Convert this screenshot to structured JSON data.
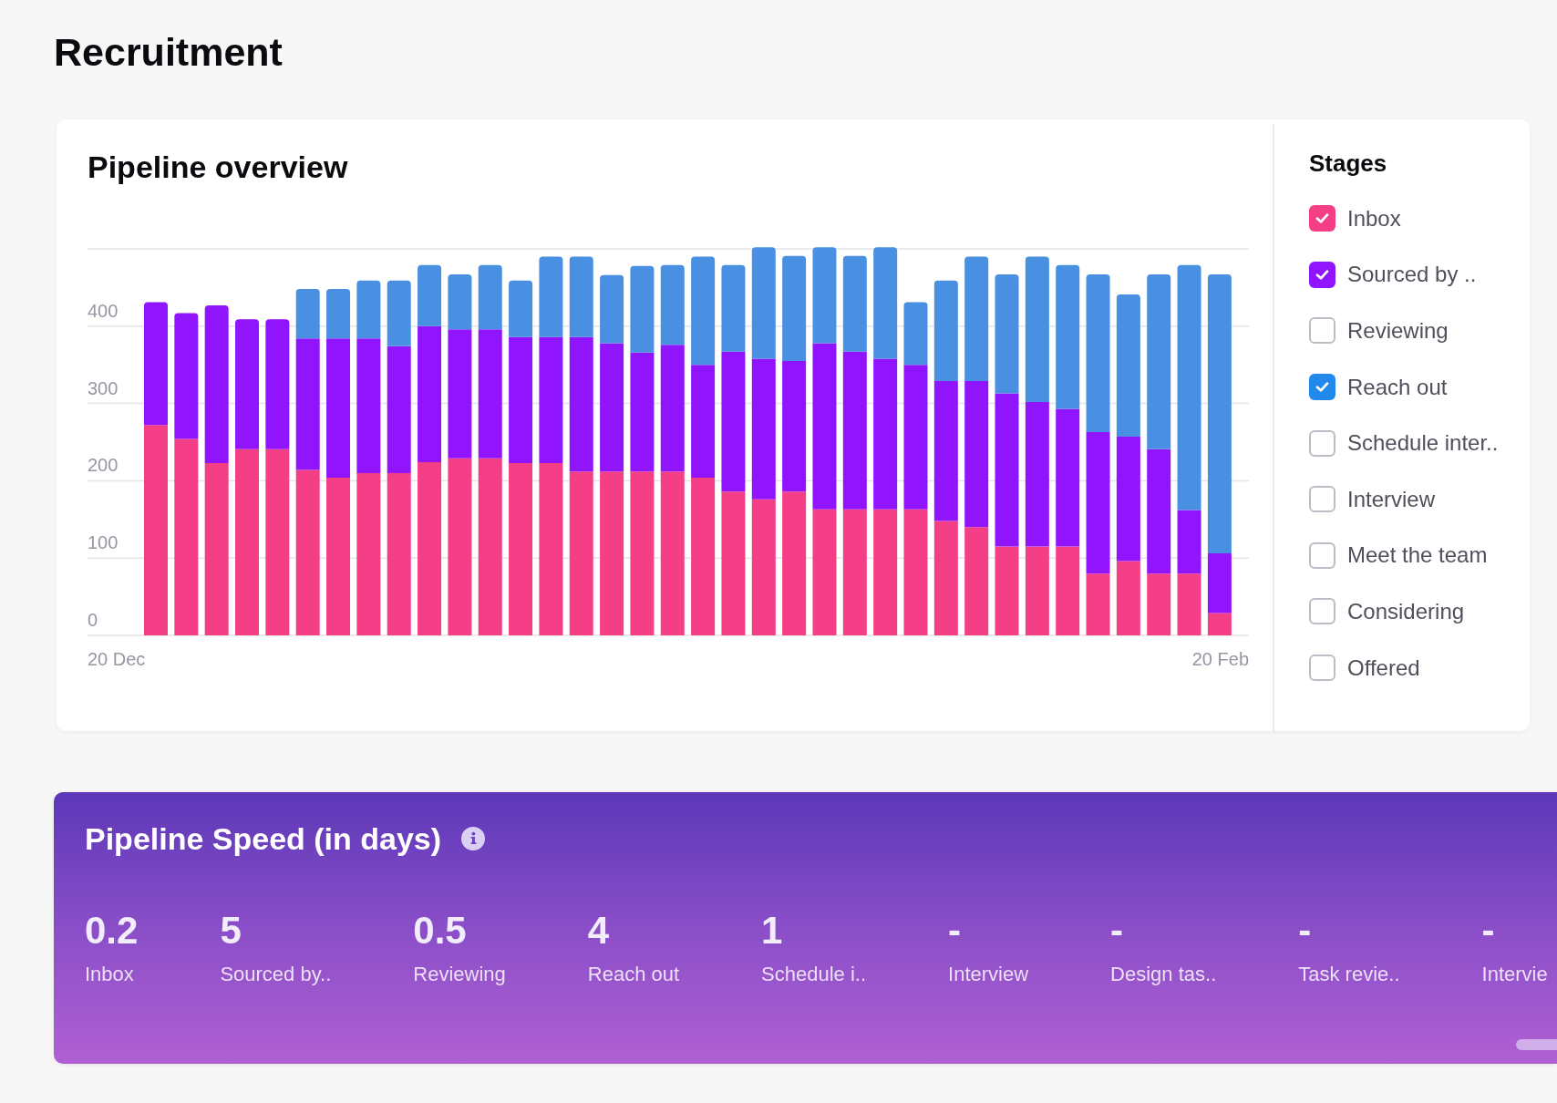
{
  "page": {
    "title": "Recruitment"
  },
  "pipeline_overview": {
    "title": "Pipeline overview",
    "x_range_labels": [
      "20 Dec",
      "20 Feb"
    ],
    "chart_data": {
      "type": "bar",
      "stacked": true,
      "grid": true,
      "ylim": [
        0,
        500
      ],
      "yticks": [
        0,
        100,
        200,
        300,
        400
      ],
      "series": [
        {
          "color": "#f43f86",
          "values": [
            272,
            254,
            223,
            241,
            241,
            214,
            204,
            210,
            210,
            224,
            229,
            229,
            223,
            223,
            212,
            212,
            212,
            212,
            204,
            186,
            176,
            186,
            163,
            163,
            163,
            163,
            148,
            140,
            115,
            115,
            115,
            80,
            96,
            80,
            80,
            29
          ]
        },
        {
          "color": "#9115fc",
          "values": [
            159,
            163,
            204,
            168,
            168,
            170,
            180,
            174,
            164,
            176,
            167,
            167,
            163,
            163,
            174,
            166,
            154,
            164,
            146,
            181,
            182,
            169,
            215,
            204,
            195,
            187,
            181,
            189,
            198,
            187,
            178,
            183,
            161,
            161,
            82,
            77
          ]
        },
        {
          "color": "#4a90e2",
          "values": [
            0,
            0,
            0,
            0,
            0,
            64,
            64,
            75,
            85,
            79,
            71,
            83,
            73,
            104,
            104,
            88,
            112,
            103,
            140,
            112,
            144,
            136,
            124,
            124,
            144,
            81,
            130,
            161,
            154,
            188,
            186,
            204,
            184,
            226,
            317,
            361
          ]
        }
      ]
    }
  },
  "stages": {
    "title": "Stages",
    "items": [
      {
        "label": "Inbox",
        "checked": true,
        "color": "#f43f86"
      },
      {
        "label": "Sourced by ..",
        "checked": true,
        "color": "#9115fc"
      },
      {
        "label": "Reviewing",
        "checked": false
      },
      {
        "label": "Reach out",
        "checked": true,
        "color": "#2188ec"
      },
      {
        "label": "Schedule inter..",
        "checked": false
      },
      {
        "label": "Interview",
        "checked": false
      },
      {
        "label": "Meet the team",
        "checked": false
      },
      {
        "label": "Considering",
        "checked": false
      },
      {
        "label": "Offered",
        "checked": false
      }
    ]
  },
  "pipeline_speed": {
    "title": "Pipeline Speed (in days)",
    "stats": [
      {
        "value": "0.2",
        "label": "Inbox"
      },
      {
        "value": "5",
        "label": "Sourced by.."
      },
      {
        "value": "0.5",
        "label": "Reviewing"
      },
      {
        "value": "4",
        "label": "Reach out"
      },
      {
        "value": "1",
        "label": "Schedule i.."
      },
      {
        "value": "-",
        "label": "Interview"
      },
      {
        "value": "-",
        "label": "Design tas.."
      },
      {
        "value": "-",
        "label": "Task revie.."
      },
      {
        "value": "-",
        "label": "Intervie"
      }
    ]
  }
}
